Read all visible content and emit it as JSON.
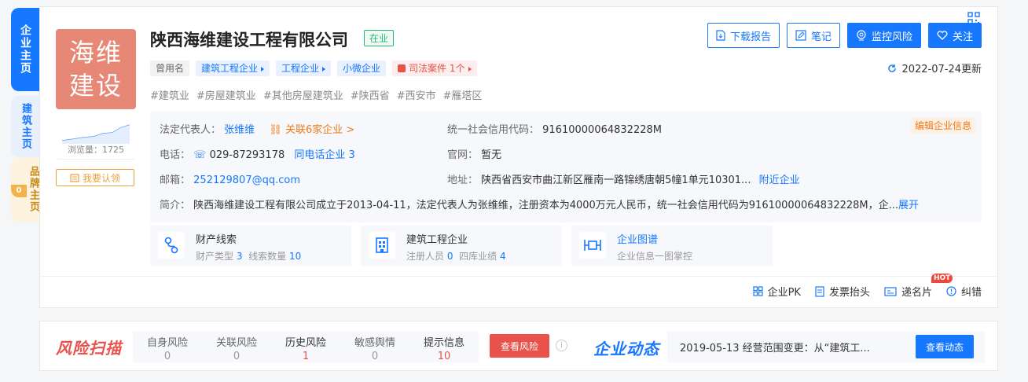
{
  "side_tabs": {
    "main": "企业主页",
    "build": "建筑主页",
    "brand": "品牌主页",
    "brand_count": "0"
  },
  "company": {
    "logo_line1": "海维",
    "logo_line2": "建设",
    "name": "陕西海维建设工程有限公司",
    "status": "在业",
    "views_label": "浏览量：1725",
    "claim_label": "我要认领",
    "tags": [
      {
        "label": "曾用名",
        "style": "gray"
      },
      {
        "label": "建筑工程企业",
        "style": "blue"
      },
      {
        "label": "工程企业",
        "style": "blue"
      },
      {
        "label": "小微企业",
        "style": "blue"
      },
      {
        "label": "司法案件 1个",
        "style": "red"
      }
    ],
    "hashtags": [
      "#建筑业",
      "#房屋建筑业",
      "#其他房屋建筑业",
      "#陕西省",
      "#西安市",
      "#雁塔区"
    ]
  },
  "actions": {
    "download": "下载报告",
    "notes": "笔记",
    "monitor": "监控风险",
    "follow": "关注",
    "updated": "2022-07-24更新"
  },
  "info": {
    "legal_rep_key": "法定代表人：",
    "legal_rep": "张维维",
    "related": "关联6家企业 >",
    "phone_key": "电话：",
    "phone": "029-87293178",
    "same_phone": "同电话企业 3",
    "email_key": "邮箱：",
    "email": "252129807@qq.com",
    "credit_key": "统一社会信用代码：",
    "credit": "91610000064832228M",
    "website_key": "官网：",
    "website": "暂无",
    "address_key": "地址：",
    "address": "陕西省西安市曲江新区雁南一路锦绣唐朝5幢1单元10301...",
    "nearby": "附近企业",
    "intro_key": "简介：",
    "intro": "陕西海维建设工程有限公司成立于2013-04-11，法定代表人为张维维，注册资本为4000万元人民币，统一社会信用代码为91610000064832228M，企...",
    "expand": "展开",
    "edit": "编辑企业信息"
  },
  "features": [
    {
      "title": "财产线索",
      "sub1": "财产类型",
      "v1": "3",
      "sub2": "线索数量",
      "v2": "10"
    },
    {
      "title": "建筑工程企业",
      "sub1": "注册人员",
      "v1": "0",
      "sub2": "四库业绩",
      "v2": "4"
    },
    {
      "title": "企业图谱",
      "sub_text": "企业信息一图掌控"
    }
  ],
  "tools": {
    "pk": "企业PK",
    "invoice": "发票抬头",
    "card": "递名片",
    "hot": "HOT",
    "correct": "纠错"
  },
  "risk": {
    "logo": "风险扫描",
    "cells": [
      {
        "label": "自身风险",
        "value": "0"
      },
      {
        "label": "关联风险",
        "value": "0"
      },
      {
        "label": "历史风险",
        "value": "1"
      },
      {
        "label": "敏感舆情",
        "value": "0"
      },
      {
        "label": "提示信息",
        "value": "10"
      }
    ],
    "view": "查看风险",
    "help": "i"
  },
  "dynamics": {
    "logo": "企业动态",
    "text": "2019-05-13 经营范围变更：从“建筑工...",
    "view": "查看动态"
  },
  "colors": {
    "primary": "#1677ff",
    "risk": "#e8524a",
    "logo_bg": "#e78776",
    "ok": "#2bb673"
  }
}
